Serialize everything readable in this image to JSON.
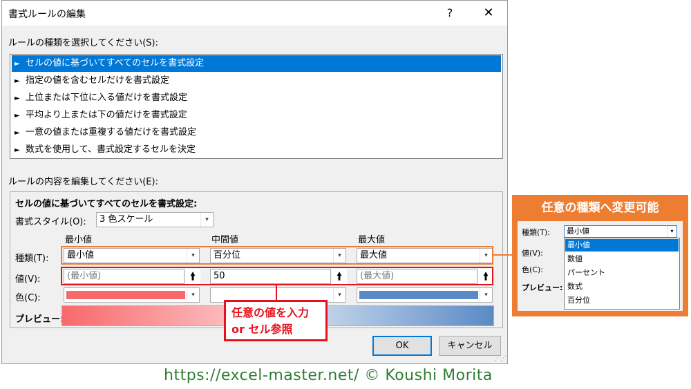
{
  "dialog": {
    "title": "書式ルールの編集",
    "help_label": "?",
    "close_label": "✕",
    "rule_type_label": "ルールの種類を選択してください(S):",
    "rule_types": [
      "セルの値に基づいてすべてのセルを書式設定",
      "指定の値を含むセルだけを書式設定",
      "上位または下位に入る値だけを書式設定",
      "平均より上または下の値だけを書式設定",
      "一意の値または重複する値だけを書式設定",
      "数式を使用して、書式設定するセルを決定"
    ],
    "selected_rule_index": 0,
    "rule_arrow": "►",
    "edit_label": "ルールの内容を編集してください(E):",
    "section_title": "セルの値に基づいてすべてのセルを書式設定:",
    "format_style_label": "書式スタイル(O):",
    "format_style_value": "3 色スケール",
    "col_min": "最小値",
    "col_mid": "中間値",
    "col_max": "最大値",
    "type_label": "種類(T):",
    "value_label": "値(V):",
    "color_label": "色(C):",
    "preview_label": "プレビュー:",
    "type_min": "最小値",
    "type_mid": "百分位",
    "type_max": "最大値",
    "value_min": "(最小値)",
    "value_mid": "50",
    "value_max": "(最大値)",
    "ref_symbol": "🠙",
    "dropdown_arrow": "▾",
    "ok_label": "OK",
    "cancel_label": "キャンセル"
  },
  "colors": {
    "min_color": "#f8696b",
    "mid_color": "#ffffff",
    "max_color": "#5a8ac6",
    "selection": "#0078d7",
    "annotation_orange": "#ed7d31",
    "annotation_red": "#e8101b"
  },
  "annotation_red": {
    "line1": "任意の値を入力",
    "line2": "or セル参照"
  },
  "panel": {
    "title": "任意の種類へ変更可能",
    "type_label": "種類(T):",
    "value_label": "値(V):",
    "color_label": "色(C):",
    "preview_label": "プレビュー:",
    "combo_value": "最小値",
    "options": [
      "最小値",
      "数値",
      "パーセント",
      "数式",
      "百分位"
    ],
    "selected_index": 0
  },
  "footer": {
    "text": "https://excel-master.net/ © Koushi Morita"
  }
}
